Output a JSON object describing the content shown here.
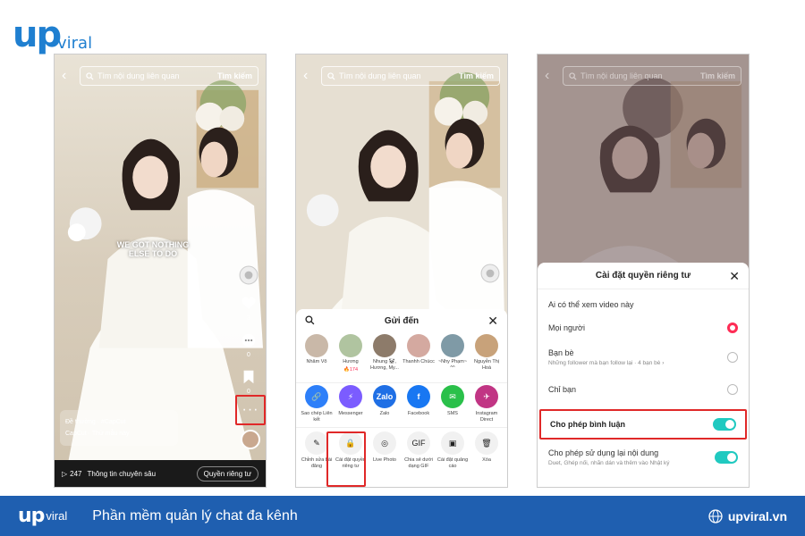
{
  "brand": {
    "logo_u": "up",
    "logo_viral": "viral",
    "slogan": "Phần mềm quản lý chat đa kênh",
    "site": "upviral.vn"
  },
  "colors": {
    "accent": "#1f5fb0",
    "highlight": "#e02828",
    "tiktok_red": "#fe2c55",
    "toggle_on": "#20c9c0"
  },
  "search": {
    "placeholder": "Tìm nội dung liên quan",
    "button": "Tìm kiếm"
  },
  "video": {
    "caption_line1": "WE GOT NOTHING",
    "caption_line2": "ELSE TO DO",
    "like_count": "3",
    "comment_count": "0",
    "bookmark_count": "0",
    "template_line1": "Đề thường · #CapCut",
    "template_line2": "CapCut · Thử mẫu này",
    "views": "247",
    "insights": "Thông tin chuyên sâu",
    "privacy_button": "Quyền riêng tư"
  },
  "share_sheet": {
    "title": "Gửi đến",
    "friends": [
      {
        "name": "Nhâm Võ",
        "color": "#c9b8a8"
      },
      {
        "name": "Hương",
        "sub": "174",
        "color": "#b0c4a0"
      },
      {
        "name": "Nhung 🐼, Hương, My...",
        "color": "#8d7b6a"
      },
      {
        "name": "Thanhh Chúcc",
        "color": "#d4a9a0"
      },
      {
        "name": "~Nhy Phạm~ ^^",
        "color": "#7f9aa6"
      },
      {
        "name": "Nguyễn Thị Hoà",
        "color": "#c8a27a"
      }
    ],
    "apps": [
      {
        "label": "Sao chép Liên kết",
        "glyph": "🔗",
        "color": "#2d7ff9"
      },
      {
        "label": "Messenger",
        "glyph": "⚡",
        "color": "#7b5cff"
      },
      {
        "label": "Zalo",
        "glyph": "Zalo",
        "color": "#1f6fe5"
      },
      {
        "label": "Facebook",
        "glyph": "f",
        "color": "#1877f2"
      },
      {
        "label": "SMS",
        "glyph": "✉",
        "color": "#2ac04a"
      },
      {
        "label": "Instagram Direct",
        "glyph": "✈",
        "color": "#c13584"
      }
    ],
    "actions": [
      {
        "label": "Chỉnh sửa bài đăng",
        "glyph": "✎"
      },
      {
        "label": "Cài đặt quyền riêng tư",
        "glyph": "🔒"
      },
      {
        "label": "Live Photo",
        "glyph": "◎"
      },
      {
        "label": "Chia sẻ dưới dạng GIF",
        "glyph": "GIF"
      },
      {
        "label": "Cài đặt quảng cáo",
        "glyph": "▣"
      },
      {
        "label": "Xóa",
        "glyph": "🗑"
      }
    ]
  },
  "privacy_panel": {
    "title": "Cài đặt quyền riêng tư",
    "who_label": "Ai có thể xem video này",
    "opt_everyone": "Mọi người",
    "opt_friends": "Bạn bè",
    "opt_friends_sub": "Những follower mà bạn follow lại · 4 bạn bè ›",
    "opt_only_me": "Chỉ bạn",
    "allow_comments": "Cho phép bình luận",
    "allow_reuse": "Cho phép sử dụng lại nội dung",
    "allow_reuse_sub": "Duet, Ghép nối, nhãn dán và thêm vào Nhật ký"
  }
}
